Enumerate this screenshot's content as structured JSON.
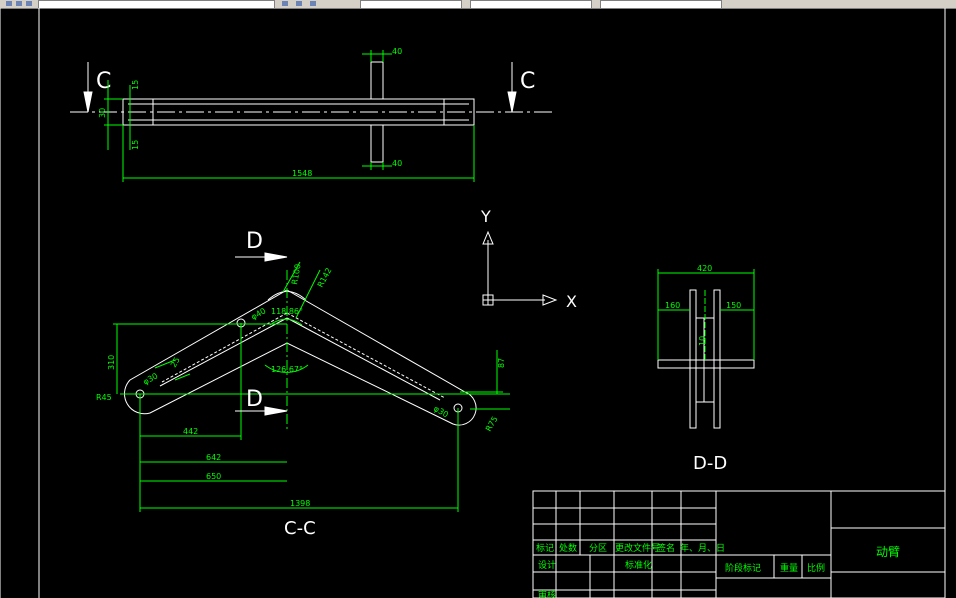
{
  "view_top": {
    "section_label_left": "C",
    "section_label_right": "C",
    "dim_length": "1548",
    "dim_stub_top": "40",
    "dim_stub_bottom": "40",
    "dim_side_top": "15",
    "dim_side_mid": "30",
    "dim_side_bottom": "15"
  },
  "view_cc": {
    "title": "C-C",
    "section_label_top": "D",
    "section_label_bottom": "D",
    "dim_r100": "R100",
    "dim_r142": "R142",
    "dim_angle_top": "118.86°",
    "dim_angle_bottom": "126.67°",
    "dim_hole_left": "φ40",
    "dim_hole_far": "φ30",
    "dim_hole_right": "φ30",
    "dim_slot": "25",
    "dim_height": "310",
    "dim_r45": "R45",
    "dim_r75": "R75",
    "dim_right_height": "87",
    "dim_442": "442",
    "dim_642": "642",
    "dim_650": "650",
    "dim_1398": "1398"
  },
  "view_dd": {
    "title": "D-D",
    "dim_width": "420",
    "dim_left": "160",
    "dim_right": "150",
    "dim_center": "10"
  },
  "ucs": {
    "x_label": "X",
    "y_label": "Y"
  },
  "title_block": {
    "row_labels": [
      "标记",
      "处数",
      "分区",
      "更改文件号",
      "签名",
      "年、月、日"
    ],
    "design": "设计",
    "standard": "标准化",
    "stage_mark": "阶段标记",
    "weight": "重量",
    "scale": "比例",
    "review": "审核",
    "part_name": "动臂"
  },
  "colors": {
    "background": "#000000",
    "outline": "#ffffff",
    "dimension": "#00ff00"
  }
}
